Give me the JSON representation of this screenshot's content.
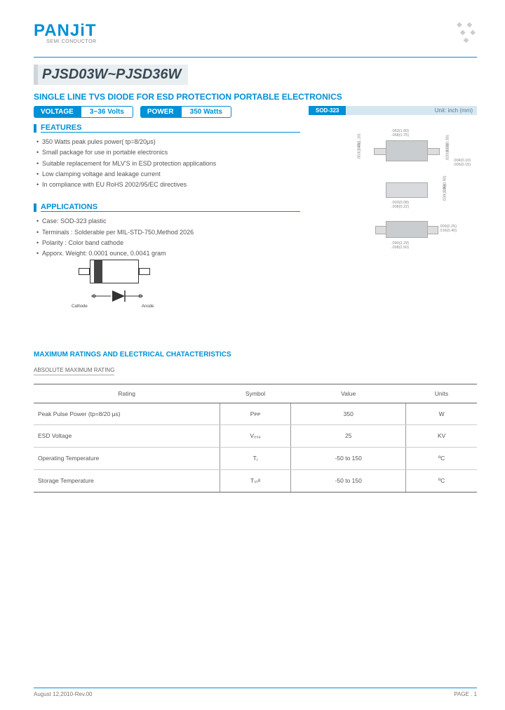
{
  "logo": {
    "part1": "PAN",
    "part2": "JiT",
    "sub": "SEMI\nCONDUCTOR"
  },
  "part_title": "PJSD03W~PJSD36W",
  "subtitle": "SINGLE LINE TVS DIODE FOR ESD PROTECTION PORTABLE ELECTRONICS",
  "specs": {
    "voltage_label": "VOLTAGE",
    "voltage_value": "3~36  Volts",
    "power_label": "POWER",
    "power_value": "350  Watts"
  },
  "package": {
    "name": "SOD-323",
    "unit": "Unit: inch (mm)"
  },
  "sections": {
    "features": {
      "title": "FEATURES",
      "items": [
        "350 Watts peak pules power( tp=8/20μs)",
        "Small package for use in portable electronics",
        "Suitable replacement for MLV'S in ESD protection applications",
        "Low clamping voltage and leakage current",
        "In compliance with EU RoHS 2002/95/EC directives"
      ]
    },
    "applications": {
      "title": "APPLICATIONS",
      "items": [
        "Case: SOD-323 plastic",
        "Terminals : Solderable per MIL-STD-750,Method 2026",
        "Polarity : Color band cathode",
        "Apporx. Weight: 0.0001 ounce, 0.0041 gram"
      ]
    }
  },
  "polarity": {
    "cathode": "Cathode",
    "anode": "Anode"
  },
  "dimensions": {
    "d1": ".063(1.60)",
    "d2": ".068(1.75)",
    "d3": ".004(0.10)",
    "d4": ".006(0.15)",
    "d5": ".043(1.10)",
    "d6": ".053(1.35)",
    "d7": ".003(0.08)",
    "d8": ".008(0.22)",
    "d9": ".090(2.29)",
    "d10": ".098(2.50)",
    "d11": ".009(0.25)",
    "d12": ".016(0.40)",
    "d13": ".035(0.90)",
    "d14": ".039(1.00)",
    "d15": ".012(0.30)",
    "d16": ".020(0.50)"
  },
  "ratings": {
    "title": "MAXIMUM RATINGS AND ELECTRICAL CHATACTERISTICS",
    "sub": "ABSOLUTE MAXIMUM RATING",
    "headers": [
      "Rating",
      "Symbol",
      "Value",
      "Units"
    ],
    "rows": [
      {
        "rating": "Peak Pulse Power (tp=8/20 μs)",
        "symbol": "Pᴘᴘ",
        "value": "350",
        "units": "W"
      },
      {
        "rating": "ESD Voltage",
        "symbol": "Vₑₛₔ",
        "value": "25",
        "units": "KV"
      },
      {
        "rating": "Operating Temperature",
        "symbol": "Tⱼ",
        "value": "-50 to 150",
        "units": "ºC"
      },
      {
        "rating": "Storage Temperature",
        "symbol": "Tₛₜᵍ",
        "value": "-50 to 150",
        "units": "ºC"
      }
    ]
  },
  "footer": {
    "date": "August 12,2010-Rev.00",
    "page": "PAGE .  1"
  }
}
